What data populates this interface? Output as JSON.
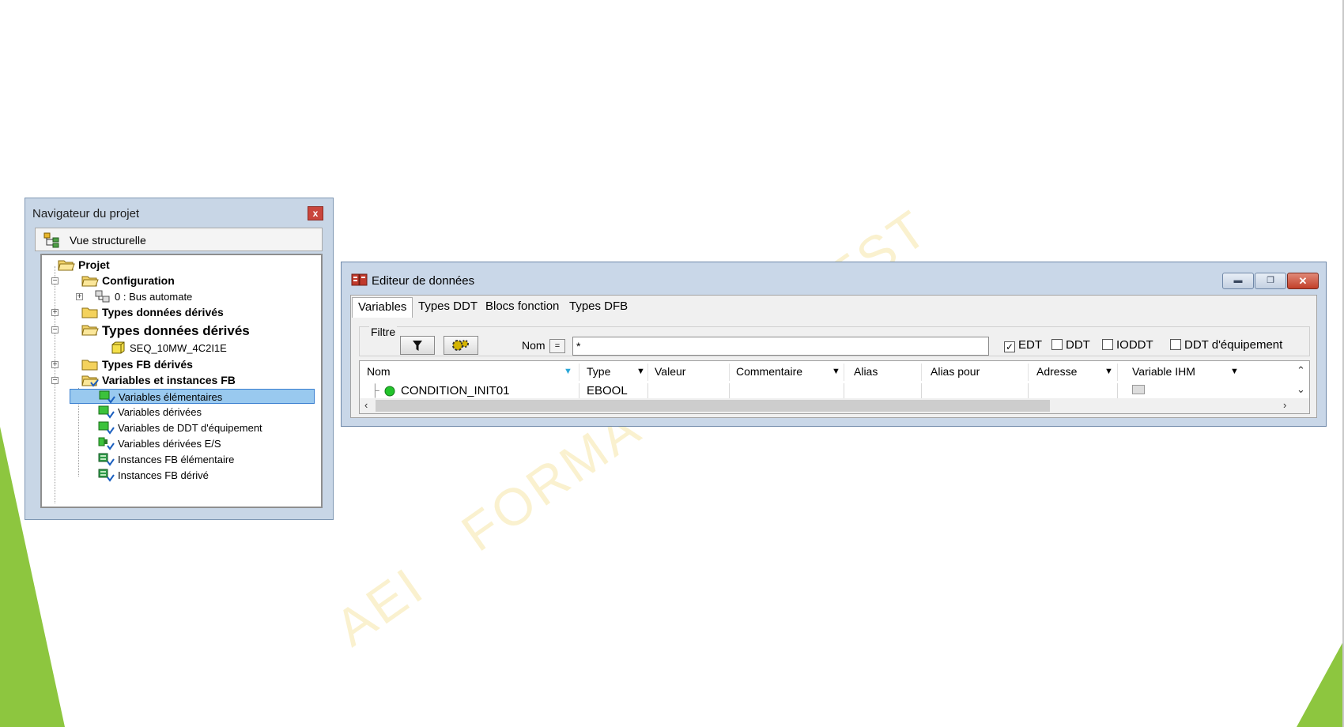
{
  "navigator": {
    "title": "Navigateur du projet",
    "close_label": "x",
    "view_label": "Vue structurelle",
    "tree": [
      {
        "label": "Projet",
        "level": 0,
        "icon": "folder-open-icon",
        "bold": true
      },
      {
        "label": "Configuration",
        "level": 1,
        "icon": "folder-open-icon",
        "bold": true,
        "expander": "minus"
      },
      {
        "label": "0 : Bus automate",
        "level": 2,
        "icon": "bus-icon",
        "bold": false,
        "expander": "plus"
      },
      {
        "label": "Types données dérivés",
        "level": 1,
        "icon": "folder-icon",
        "bold": true,
        "expander": "plus"
      },
      {
        "label": "Types données dérivés",
        "level": 1,
        "icon": "folder-open-icon",
        "bold": true,
        "expander": "minus"
      },
      {
        "label": "SEQ_10MW_4C2I1E",
        "level": 2,
        "icon": "datatype-icon",
        "bold": false
      },
      {
        "label": "Types FB dérivés",
        "level": 1,
        "icon": "folder-icon",
        "bold": true,
        "expander": "plus"
      },
      {
        "label": "Variables et instances FB",
        "level": 1,
        "icon": "folder-open-check-icon",
        "bold": true,
        "expander": "minus"
      },
      {
        "label": "Variables élémentaires",
        "level": 2,
        "icon": "variable-icon",
        "bold": false,
        "selected": true
      },
      {
        "label": "Variables dérivées",
        "level": 2,
        "icon": "variable-icon",
        "bold": false
      },
      {
        "label": "Variables de DDT d'équipement",
        "level": 2,
        "icon": "variable-icon",
        "bold": false
      },
      {
        "label": "Variables dérivées E/S",
        "level": 2,
        "icon": "variable-io-icon",
        "bold": false
      },
      {
        "label": "Instances FB élémentaire",
        "level": 2,
        "icon": "fb-instance-icon",
        "bold": false
      },
      {
        "label": "Instances FB dérivé",
        "level": 2,
        "icon": "fb-instance-icon",
        "bold": false
      }
    ]
  },
  "editor": {
    "title": "Editeur de données",
    "tabs": [
      "Variables",
      "Types DDT",
      "Blocs fonction",
      "Types DFB"
    ],
    "active_tab": "Variables",
    "filter": {
      "label": "Filtre",
      "name_label": "Nom",
      "eq_label": "=",
      "value": "*",
      "checkboxes": [
        {
          "label": "EDT",
          "checked": true
        },
        {
          "label": "DDT",
          "checked": false
        },
        {
          "label": "IODDT",
          "checked": false
        },
        {
          "label": "DDT d'équipement",
          "checked": false
        }
      ]
    },
    "columns": [
      "Nom",
      "Type",
      "Valeur",
      "Commentaire",
      "Alias",
      "Alias pour",
      "Adresse",
      "Variable IHM"
    ],
    "rows": [
      {
        "nom": "CONDITION_INIT01",
        "type": "EBOOL",
        "valeur": "",
        "commentaire": "",
        "alias": "",
        "alias_pour": "",
        "adresse": "",
        "variable_ihm": ""
      }
    ]
  },
  "watermark": [
    "AEI",
    "FORMA",
    "EST"
  ],
  "colors": {
    "accent_green": "#8dc63f",
    "selection": "#99c9ef",
    "watermark": "#f6e7a8"
  }
}
